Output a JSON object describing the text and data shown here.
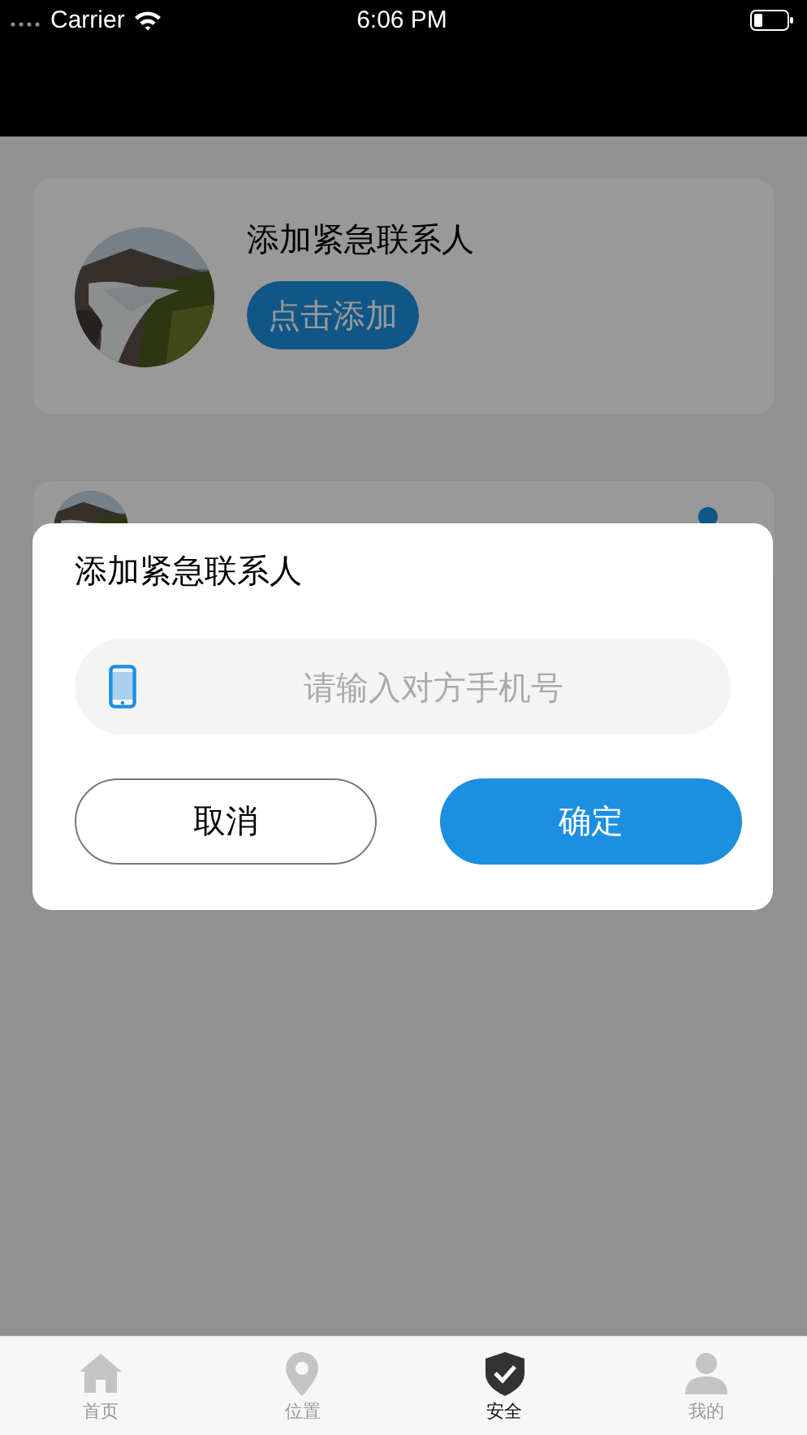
{
  "status_bar": {
    "carrier": "Carrier",
    "time": "6:06 PM"
  },
  "add_card": {
    "title": "添加紧急联系人",
    "button": "点击添加"
  },
  "dialog": {
    "title": "添加紧急联系人",
    "phone_field": {
      "placeholder": "请输入对方手机号"
    },
    "buttons": [
      {
        "label": "取消",
        "kind": "secondary"
      },
      {
        "label": "确定",
        "kind": "primary"
      }
    ]
  },
  "tabs": [
    {
      "label": "首页",
      "kind": "home",
      "selected": false
    },
    {
      "label": "位置",
      "kind": "location",
      "selected": false
    },
    {
      "label": "安全",
      "kind": "safety",
      "selected": true
    },
    {
      "label": "我的",
      "kind": "profile",
      "selected": false
    }
  ]
}
